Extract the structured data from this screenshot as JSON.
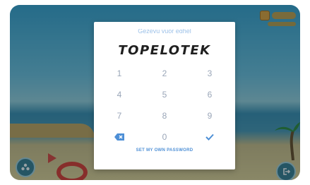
{
  "app": {
    "brand": "TOPELOTEK"
  },
  "modal": {
    "prompt": "Gezeyu yuor eghel"
  },
  "keypad": {
    "rows": [
      [
        "1",
        "2",
        "3"
      ],
      [
        "4",
        "5",
        "6"
      ],
      [
        "7",
        "8",
        "9"
      ]
    ],
    "bottom": {
      "backspace_icon": "backspace-icon",
      "zero": "0",
      "confirm_icon": "checkmark-icon"
    }
  },
  "link": {
    "set_own_password": "SET MY OWN PASSWORD"
  },
  "colors": {
    "accent": "#4d8fd6",
    "key_text": "#9aa6b8"
  }
}
